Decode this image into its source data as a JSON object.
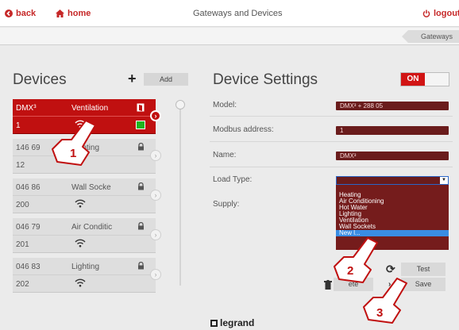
{
  "header": {
    "back_label": "back",
    "home_label": "home",
    "title": "Gateways and Devices",
    "logout_label": "logout"
  },
  "breadcrumb": {
    "current": "Gateways"
  },
  "devices": {
    "title": "Devices",
    "add_label": "Add",
    "items": [
      {
        "model": "DMX³",
        "type": "Ventilation",
        "address": "1",
        "selected": true
      },
      {
        "model": "146 69",
        "type": "Lighting",
        "address": "12",
        "selected": false
      },
      {
        "model": "046 86",
        "type": "Wall Socke",
        "address": "200",
        "selected": false
      },
      {
        "model": "046 79",
        "type": "Air Conditic",
        "address": "201",
        "selected": false
      },
      {
        "model": "046 83",
        "type": "Lighting",
        "address": "202",
        "selected": false
      }
    ]
  },
  "settings": {
    "title": "Device Settings",
    "toggle_label": "ON",
    "model_label": "Model:",
    "model_value": "DMX³ + 288 05",
    "modbus_label": "Modbus address:",
    "modbus_value": "1",
    "name_label": "Name:",
    "name_value": "DMX³",
    "load_type_label": "Load Type:",
    "supply_label": "Supply:",
    "load_type_options": [
      "Heating",
      "Air Conditioning",
      "Hot Water",
      "Lighting",
      "Ventilation",
      "Wall Sockets",
      "New l..."
    ],
    "highlighted_option": "New l...",
    "test_label": "Test",
    "delete_label": "ete",
    "save_label": "Save"
  },
  "footer": {
    "brand": "legrand"
  },
  "annotations": [
    "1",
    "2",
    "3"
  ],
  "colors": {
    "accent": "#c01010",
    "field": "#6a1c1c",
    "highlight": "#3a8de3"
  }
}
